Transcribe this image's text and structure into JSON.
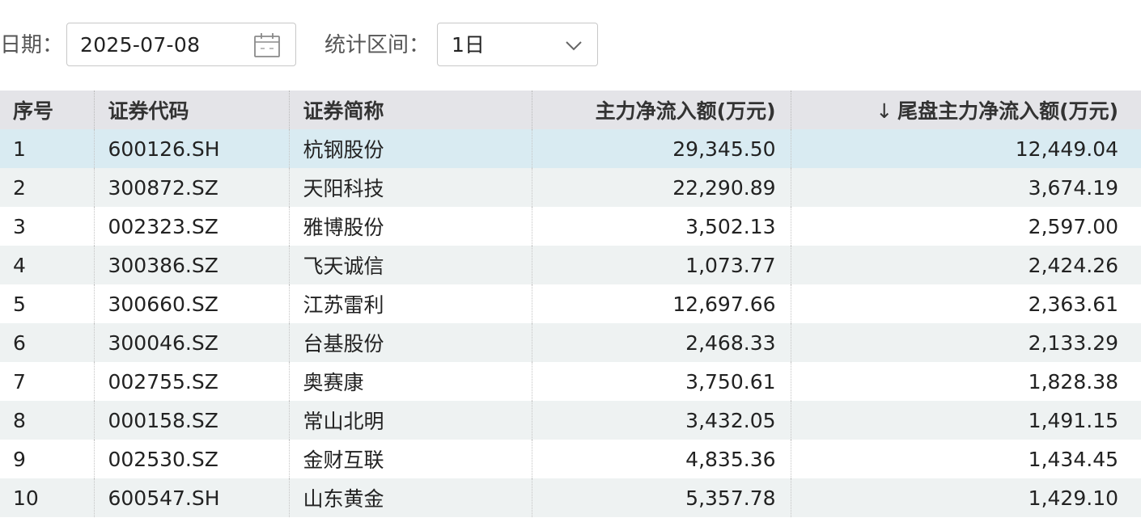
{
  "filters": {
    "date_label": "日期：",
    "date_value": "2025-07-08",
    "date_icon": "calendar-icon",
    "range_label": "统计区间：",
    "range_value": "1日",
    "range_icon": "chevron-down-icon"
  },
  "table": {
    "headers": {
      "index": "序号",
      "code": "证券代码",
      "name": "证券简称",
      "main_flow": "主力净流入额(万元)",
      "tail_flow": "尾盘主力净流入额(万元)",
      "sort_indicator": "↓"
    },
    "rows": [
      {
        "index": "1",
        "code": "600126.SH",
        "name": "杭钢股份",
        "main_flow": "29,345.50",
        "tail_flow": "12,449.04"
      },
      {
        "index": "2",
        "code": "300872.SZ",
        "name": "天阳科技",
        "main_flow": "22,290.89",
        "tail_flow": "3,674.19"
      },
      {
        "index": "3",
        "code": "002323.SZ",
        "name": "雅博股份",
        "main_flow": "3,502.13",
        "tail_flow": "2,597.00"
      },
      {
        "index": "4",
        "code": "300386.SZ",
        "name": "飞天诚信",
        "main_flow": "1,073.77",
        "tail_flow": "2,424.26"
      },
      {
        "index": "5",
        "code": "300660.SZ",
        "name": "江苏雷利",
        "main_flow": "12,697.66",
        "tail_flow": "2,363.61"
      },
      {
        "index": "6",
        "code": "300046.SZ",
        "name": "台基股份",
        "main_flow": "2,468.33",
        "tail_flow": "2,133.29"
      },
      {
        "index": "7",
        "code": "002755.SZ",
        "name": "奥赛康",
        "main_flow": "3,750.61",
        "tail_flow": "1,828.38"
      },
      {
        "index": "8",
        "code": "000158.SZ",
        "name": "常山北明",
        "main_flow": "3,432.05",
        "tail_flow": "1,491.15"
      },
      {
        "index": "9",
        "code": "002530.SZ",
        "name": "金财互联",
        "main_flow": "4,835.36",
        "tail_flow": "1,434.45"
      },
      {
        "index": "10",
        "code": "600547.SH",
        "name": "山东黄金",
        "main_flow": "5,357.78",
        "tail_flow": "1,429.10"
      }
    ],
    "selected_row": 0
  },
  "colors": {
    "header_bg": "#e4e4e8",
    "row_alt_bg": "#eef2f2",
    "row_selected_bg": "#d9ebf2",
    "border": "#c8c8c8"
  }
}
